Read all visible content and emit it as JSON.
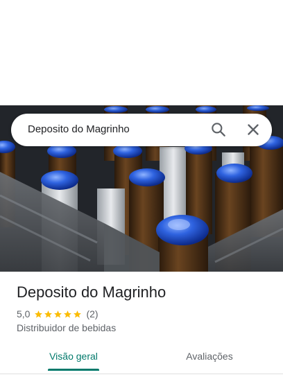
{
  "search": {
    "query": "Deposito do Magrinho",
    "search_icon": "search-icon",
    "close_icon": "close-icon"
  },
  "place": {
    "title": "Deposito do Magrinho",
    "rating": "5,0",
    "rating_value": 5,
    "review_count": "(2)",
    "category": "Distribuidor de bebidas"
  },
  "tabs": [
    {
      "label": "Visão geral",
      "active": true
    },
    {
      "label": "Avaliações",
      "active": false
    }
  ],
  "colors": {
    "accent": "#00796b",
    "star": "#fbbc04",
    "bottle_cap": "#2f63e0"
  }
}
